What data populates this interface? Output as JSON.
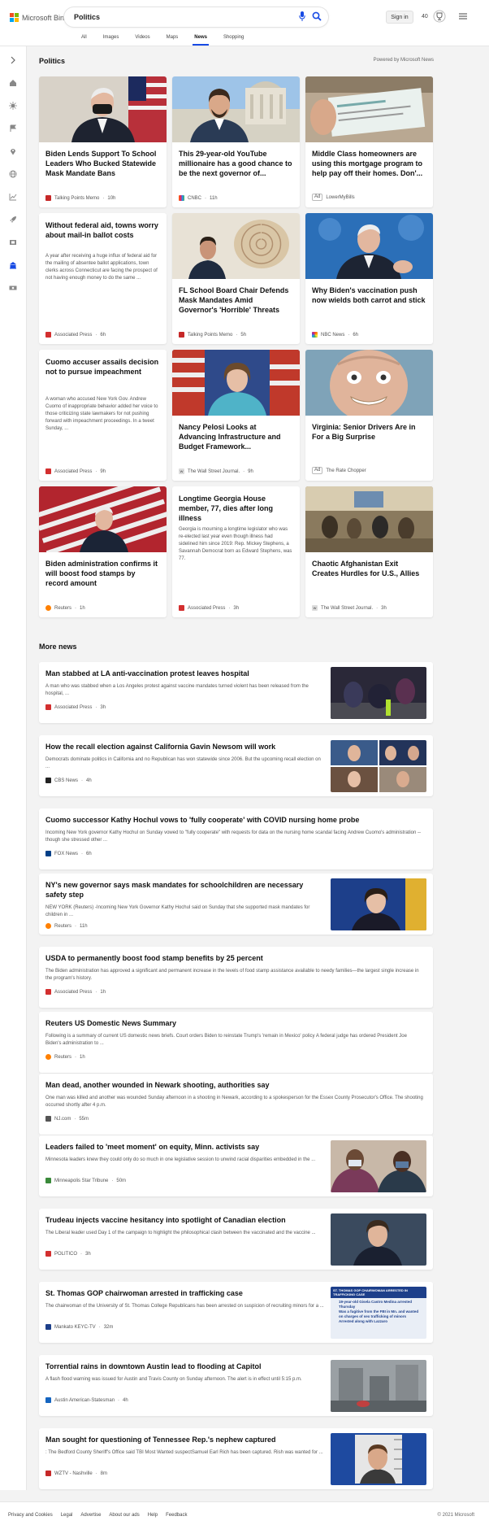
{
  "header": {
    "brand": "Microsoft Bing",
    "search_value": "Politics",
    "signin_label": "Sign in",
    "rewards_count": "40",
    "tabs": [
      "All",
      "Images",
      "Videos",
      "Maps",
      "News",
      "Shopping"
    ],
    "active_tab": "News"
  },
  "section": {
    "title": "Politics",
    "powered_by": "Powered by Microsoft News"
  },
  "cards": [
    {
      "title": "Biden Lends Support To School Leaders Who Bucked Statewide Mask Mandate Bans",
      "snippet": "",
      "source": "Talking Points Memo",
      "time": "10h",
      "ad": false,
      "icon": "tpm"
    },
    {
      "title": "This 29-year-old YouTube millionaire has a good chance to be the next governor of...",
      "snippet": "",
      "source": "CNBC",
      "time": "11h",
      "ad": false,
      "icon": "cnbc"
    },
    {
      "title": "Middle Class homeowners are using this mortgage program to help pay off their homes. Don'...",
      "snippet": "",
      "source": "LowerMyBills",
      "time": "",
      "ad": true,
      "icon": "none"
    },
    {
      "title": "Without federal aid, towns worry about mail-in ballot costs",
      "snippet": "A year after receiving a huge influx of federal aid for the mailing of absentee ballot applications, town clerks across Connecticut are facing the prospect of not having enough money to do the same ...",
      "source": "Associated Press",
      "time": "6h",
      "ad": false,
      "icon": "ap"
    },
    {
      "title": "FL School Board Chair Defends Mask Mandates Amid Governor's 'Horrible' Threats",
      "snippet": "",
      "source": "Talking Points Memo",
      "time": "5h",
      "ad": false,
      "icon": "tpm"
    },
    {
      "title": "Why Biden's vaccination push now wields both carrot and stick",
      "snippet": "",
      "source": "NBC News",
      "time": "6h",
      "ad": false,
      "icon": "nbc"
    },
    {
      "title": "Cuomo accuser assails decision not to pursue impeachment",
      "snippet": "A woman who accused New York Gov. Andrew Cuomo of inappropriate behavior added her voice to those criticizing state lawmakers for not pushing forward with impeachment proceedings. In a tweet Sunday, ...",
      "source": "Associated Press",
      "time": "9h",
      "ad": false,
      "icon": "ap"
    },
    {
      "title": "Nancy Pelosi Looks at Advancing Infrastructure and Budget Framework...",
      "snippet": "",
      "source": "The Wall Street Journal.",
      "time": "9h",
      "ad": false,
      "icon": "wsj"
    },
    {
      "title": "Virginia: Senior Drivers Are in For a Big Surprise",
      "snippet": "",
      "source": "The Rate Chopper",
      "time": "",
      "ad": true,
      "icon": "none"
    },
    {
      "title": "Biden administration confirms it will boost food stamps by record amount",
      "snippet": "",
      "source": "Reuters",
      "time": "1h",
      "ad": false,
      "icon": "reuters"
    },
    {
      "title": "Longtime Georgia House member, 77, dies after long illness",
      "snippet": "Georgia is mourning a longtime legislator who was re-elected last year even though illness had sidelined him since 2019: Rep. Mickey Stephens, a Savannah Democrat born as Edward Stephens, was 77.",
      "source": "Associated Press",
      "time": "3h",
      "ad": false,
      "icon": "ap"
    },
    {
      "title": "Chaotic Afghanistan Exit Creates Hurdles for U.S., Allies",
      "snippet": "",
      "source": "The Wall Street Journal.",
      "time": "3h",
      "ad": false,
      "icon": "wsj"
    }
  ],
  "more_news": {
    "title": "More news",
    "items": [
      {
        "title": "Man stabbed at LA anti-vaccination protest leaves hospital",
        "snippet": "A man who was stabbed when a Los Angeles protest against vaccine mandates turned violent has been released from the hospital, ...",
        "source": "Associated Press",
        "time": "3h",
        "icon": "ap",
        "thumb": "protest"
      },
      {
        "title": "How the recall election against California Gavin Newsom will work",
        "snippet": "Democrats dominate politics in California and no Republican has won statewide since 2006. But the upcoming recall election on ...",
        "source": "CBS News",
        "time": "4h",
        "icon": "cbs",
        "thumb": "collage"
      },
      {
        "title": "Cuomo successor Kathy Hochul vows to 'fully cooperate' with COVID nursing home probe",
        "snippet": "Incoming New York governor Kathy Hochul on Sunday vowed to \"fully cooperate\" with requests for data on the nursing home scandal facing Andrew Cuomo's administration -- though she stressed other ...",
        "source": "FOX News",
        "time": "6h",
        "icon": "fox",
        "thumb": ""
      },
      {
        "title": "NY's new governor says mask mandates for schoolchildren are necessary safety step",
        "snippet": "NEW YORK (Reuters) -Incoming New York Governor Kathy Hochul said on Sunday that she supported mask mandates for children in ...",
        "source": "Reuters",
        "time": "11h",
        "icon": "reuters",
        "thumb": "hochul"
      },
      {
        "title": "USDA to permanently boost food stamp benefits by 25 percent",
        "snippet": "The Biden administration has approved a significant and permanent increase in the levels of food stamp assistance available to needy families—the largest single increase in the program's history.",
        "source": "Associated Press",
        "time": "1h",
        "icon": "ap",
        "thumb": ""
      },
      {
        "title": "Reuters US Domestic News Summary",
        "snippet": "Following is a summary of current US domestic news briefs. Court orders Biden to reinstate Trump's 'remain in Mexico' policy A federal judge has ordered President Joe Biden's administration to ...",
        "source": "Reuters",
        "time": "1h",
        "icon": "reuters",
        "thumb": ""
      },
      {
        "title": "Man dead, another wounded in Newark shooting, authorities say",
        "snippet": "One man was killed and another was wounded Sunday afternoon in a shooting in Newark, according to a spokesperson for the Essex County Prosecutor's Office. The shooting occurred shortly after 4 p.m.",
        "source": "NJ.com",
        "time": "55m",
        "icon": "nj",
        "thumb": ""
      },
      {
        "title": "Leaders failed to 'meet moment' on equity, Minn. activists say",
        "snippet": "Minnesota leaders knew they could only do so much in one legislative session to unwind racial disparities embedded in the ...",
        "source": "Minneapolis Star Tribune",
        "time": "50m",
        "icon": "star",
        "thumb": "masks"
      },
      {
        "title": "Trudeau injects vaccine hesitancy into spotlight of Canadian election",
        "snippet": "The Liberal leader used Day 1 of the campaign to highlight the philosophical clash between the vaccinated and the vaccine ...",
        "source": "POLITICO",
        "time": "3h",
        "icon": "politico",
        "thumb": "trudeau"
      },
      {
        "title": "St. Thomas GOP chairwoman arrested in trafficking case",
        "snippet": "The chairwoman of the University of St. Thomas College Republicans has been arrested on suspicion of recruiting minors for a ...",
        "source": "Mankato KEYC-TV",
        "time": "32m",
        "icon": "keyc",
        "thumb": "graphic"
      },
      {
        "title": "Torrential rains in downtown Austin lead to flooding at Capitol",
        "snippet": "A flash flood warning was issued for Austin and Travis County on Sunday afternoon. The alert is in effect until 5:15 p.m.",
        "source": "Austin American-Statesman",
        "time": "4h",
        "icon": "aas",
        "thumb": "rain"
      },
      {
        "title": "Man sought for questioning of Tennessee Rep.'s nephew captured",
        "snippet": ": The Bedford County Sheriff's Office said TBI Most Wanted suspectSamuel Earl Rich has been captured. Rish was wanted for ...",
        "source": "WZTV - Nashville",
        "time": "8m",
        "icon": "wztv",
        "thumb": "mugshot"
      }
    ]
  },
  "thumb_texts": {
    "graphic_head": "ST. THOMAS GOP CHAIRWOMAN ARRESTED IN TRAFFICKING CASE",
    "graphic_lines": [
      "19-year-old Gisela Castro Medina arrested Thursday",
      "Was a fugitive from the FBI in Mn. and wanted on charges of sex trafficking of minors",
      "Arrested along with Lazzaro"
    ]
  },
  "footer": {
    "links": [
      "Privacy and Cookies",
      "Legal",
      "Advertise",
      "About our ads",
      "Help",
      "Feedback"
    ],
    "copyright": "© 2021 Microsoft"
  }
}
